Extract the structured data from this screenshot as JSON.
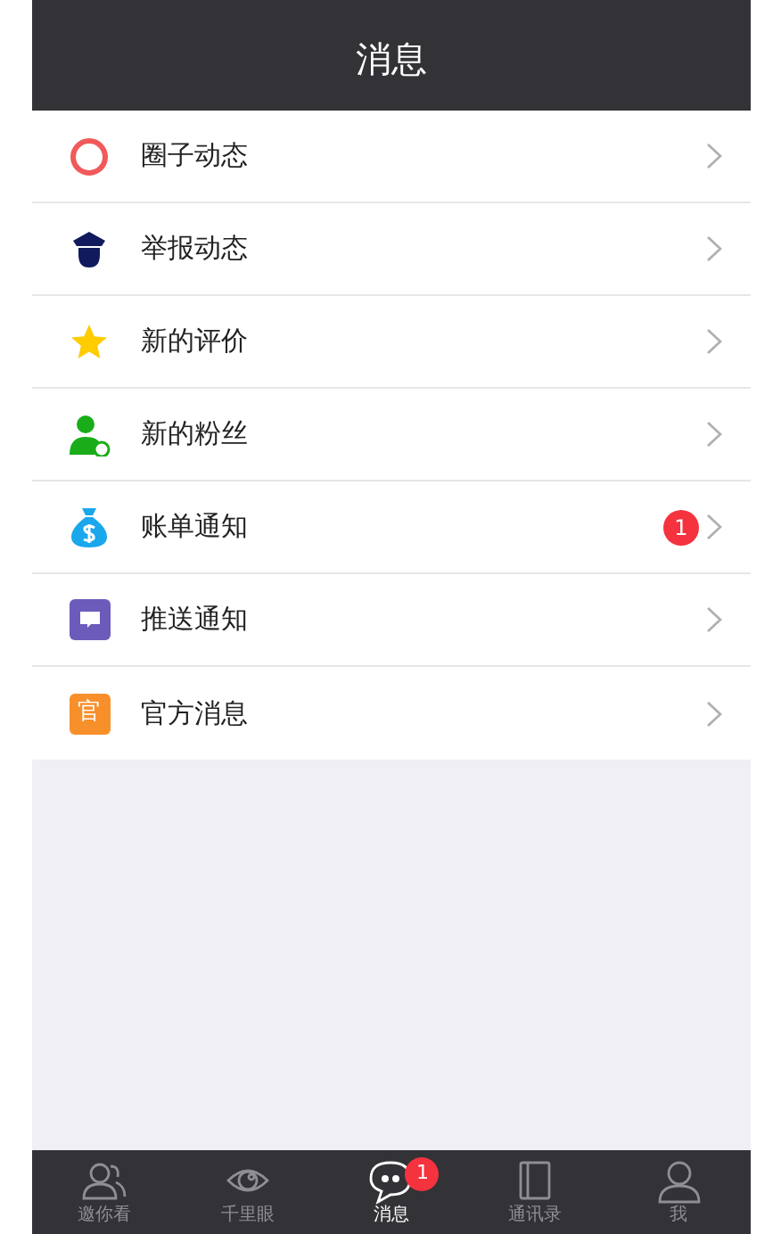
{
  "header": {
    "title": "消息"
  },
  "items": [
    {
      "kind": "circle",
      "label": "圈子动态"
    },
    {
      "kind": "police",
      "label": "举报动态"
    },
    {
      "kind": "star",
      "label": "新的评价"
    },
    {
      "kind": "fan",
      "label": "新的粉丝"
    },
    {
      "kind": "money",
      "label": "账单通知",
      "badge": "1"
    },
    {
      "kind": "chat",
      "label": "推送通知"
    },
    {
      "kind": "official",
      "label": "官方消息",
      "icon_text": "官"
    }
  ],
  "tab_bar": [
    {
      "kind": "people",
      "label": "邀你看",
      "selected": false
    },
    {
      "kind": "eye",
      "label": "千里眼",
      "selected": false
    },
    {
      "kind": "bubble",
      "label": "消息",
      "selected": true,
      "badge": "1"
    },
    {
      "kind": "book",
      "label": "通讯录",
      "selected": false
    },
    {
      "kind": "person",
      "label": "我",
      "selected": false
    }
  ]
}
